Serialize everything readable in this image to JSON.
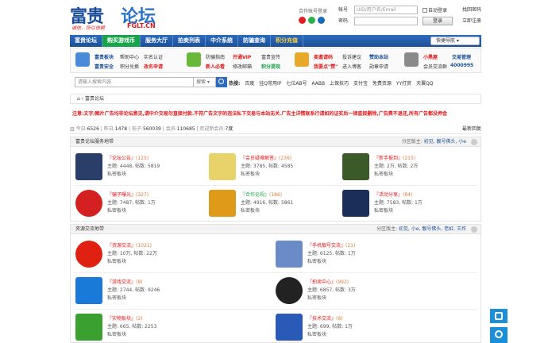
{
  "logo": {
    "big": "富贵",
    "lt": "论坛",
    "sub": "诚信，所以信赖",
    "en": "FGLT.CN"
  },
  "header": {
    "coop_login": "合作账号登录",
    "account_label": "帐号",
    "account_placeholder": "UID/用户名/Email",
    "auto_login": "自动登录",
    "find_pwd": "找回密码",
    "password_label": "密码",
    "login_button": "登录",
    "register": "立即注册"
  },
  "nav": {
    "items": [
      "富贵论坛",
      "购买游戏币",
      "服务大厅",
      "拍卖列表",
      "中介系统",
      "防骗查询",
      "积分充值"
    ],
    "quick_nav": "快捷导航"
  },
  "quick_panel": {
    "g1": [
      "富贵板块",
      "帮助中心",
      "实名认证",
      "富贵安全",
      "积分兑换",
      "改名申请"
    ],
    "g2": [
      "防骗指南",
      "开通VIP",
      "富贵宣传",
      "新人必看",
      "修改邮箱",
      "积分提现"
    ],
    "g3": [
      "卖邀请码",
      "投诉建议",
      "赞助本站",
      "我要点\"赞\"",
      "进入博客",
      "勋章申请"
    ],
    "g4": [
      "小黑屋",
      "交易管理",
      "会员交流群",
      "4000995"
    ]
  },
  "search": {
    "placeholder": "请输入搜索内容",
    "type": "搜索",
    "hot_label": "热搜:",
    "hot": [
      "百度",
      "挂Q常用IP",
      "七位AB号",
      "AABB",
      "上保技巧",
      "支付宝",
      "免费资源",
      "YY打赏",
      "天翼QQ"
    ]
  },
  "breadcrumb": "富贵论坛",
  "notice": "注意:文字/图片广告均非论坛意见,请中介交易勿直接付款.不符广告文字的违法私下交易与本站无关.广告主详情联系行请如的证实后一律直接删除,广告费不退还,所有广告都没押金",
  "stats": {
    "today_label": "今日:",
    "today": "6526",
    "yesterday_label": "昨日:",
    "yesterday": "1478",
    "posts_label": "帖子:",
    "posts": "560039",
    "members_label": "会员:",
    "members": "110685",
    "newest_label": "欢迎新会员:",
    "newest": "7度",
    "latest": "最新回复"
  },
  "section1": {
    "title": "富贵论坛服务地带",
    "mod_label": "分区版主:",
    "mods": "初见, 靓号佛头, 小e",
    "forums": [
      {
        "name": "『论坛公告』",
        "count": "(125)",
        "topics": "主题: 4448, 帖数: 5819",
        "private": "私密板块",
        "color": "#2a3e6a"
      },
      {
        "name": "『会员疑难解答』",
        "count": "(236)",
        "topics": "主题: 3785, 帖数: 4585",
        "private": "私密板块",
        "color": "#e8d36a"
      },
      {
        "name": "『新手报到』",
        "count": "(215)",
        "topics": "主题: 2万, 帖数: 2万",
        "private": "私密板块",
        "color": "#3a5a2a"
      },
      {
        "name": "『骗子曝光』",
        "count": "(327)",
        "topics": "主题: 7487, 帖数: 1万",
        "private": "私密板块",
        "color": "#d42020"
      },
      {
        "name": "『合作论视』",
        "count": "(186)",
        "topics": "主题: 4916, 帖数: 5861",
        "private": "私密板块",
        "color": "#e09a1a"
      },
      {
        "name": "『活动分享』",
        "count": "(84)",
        "topics": "主题: 7583, 帖数: 1万",
        "private": "私密板块",
        "color": "#1a2e5a"
      }
    ]
  },
  "section2": {
    "title": "资源交流地带",
    "mod_label": "分区版主:",
    "mods": "初见, 小e, 靓号佛头, 老虹, 王炸",
    "forums": [
      {
        "name": "『资源交流』",
        "count": "(1021)",
        "topics": "主题: 10万, 帖数: 22万",
        "private": "私密板块",
        "color": "#e02010"
      },
      {
        "name": "『手机靓号交流』",
        "count": "(21)",
        "topics": "主题: 6125, 帖数: 1万",
        "private": "私密板块",
        "color": "#6a8ac8"
      },
      {
        "name": "『游戏交流』",
        "count": "(8)",
        "topics": "主题: 2744, 帖数: 9246",
        "private": "私密板块",
        "color": "#1a7ad8"
      },
      {
        "name": "『拍卖中心』",
        "count": "(992)",
        "topics": "主题: 6857, 帖数: 3万",
        "private": "私密板块",
        "color": "#222222"
      },
      {
        "name": "『实物板块』",
        "count": "(2)",
        "topics": "主题: 665, 帖数: 2253",
        "private": "私密板块",
        "color": "#3aa030"
      },
      {
        "name": "『技术交流』",
        "count": "(8)",
        "topics": "主题: 699, 帖数: 1万",
        "private": "私密板块",
        "color": "#2a5ab8"
      }
    ]
  }
}
